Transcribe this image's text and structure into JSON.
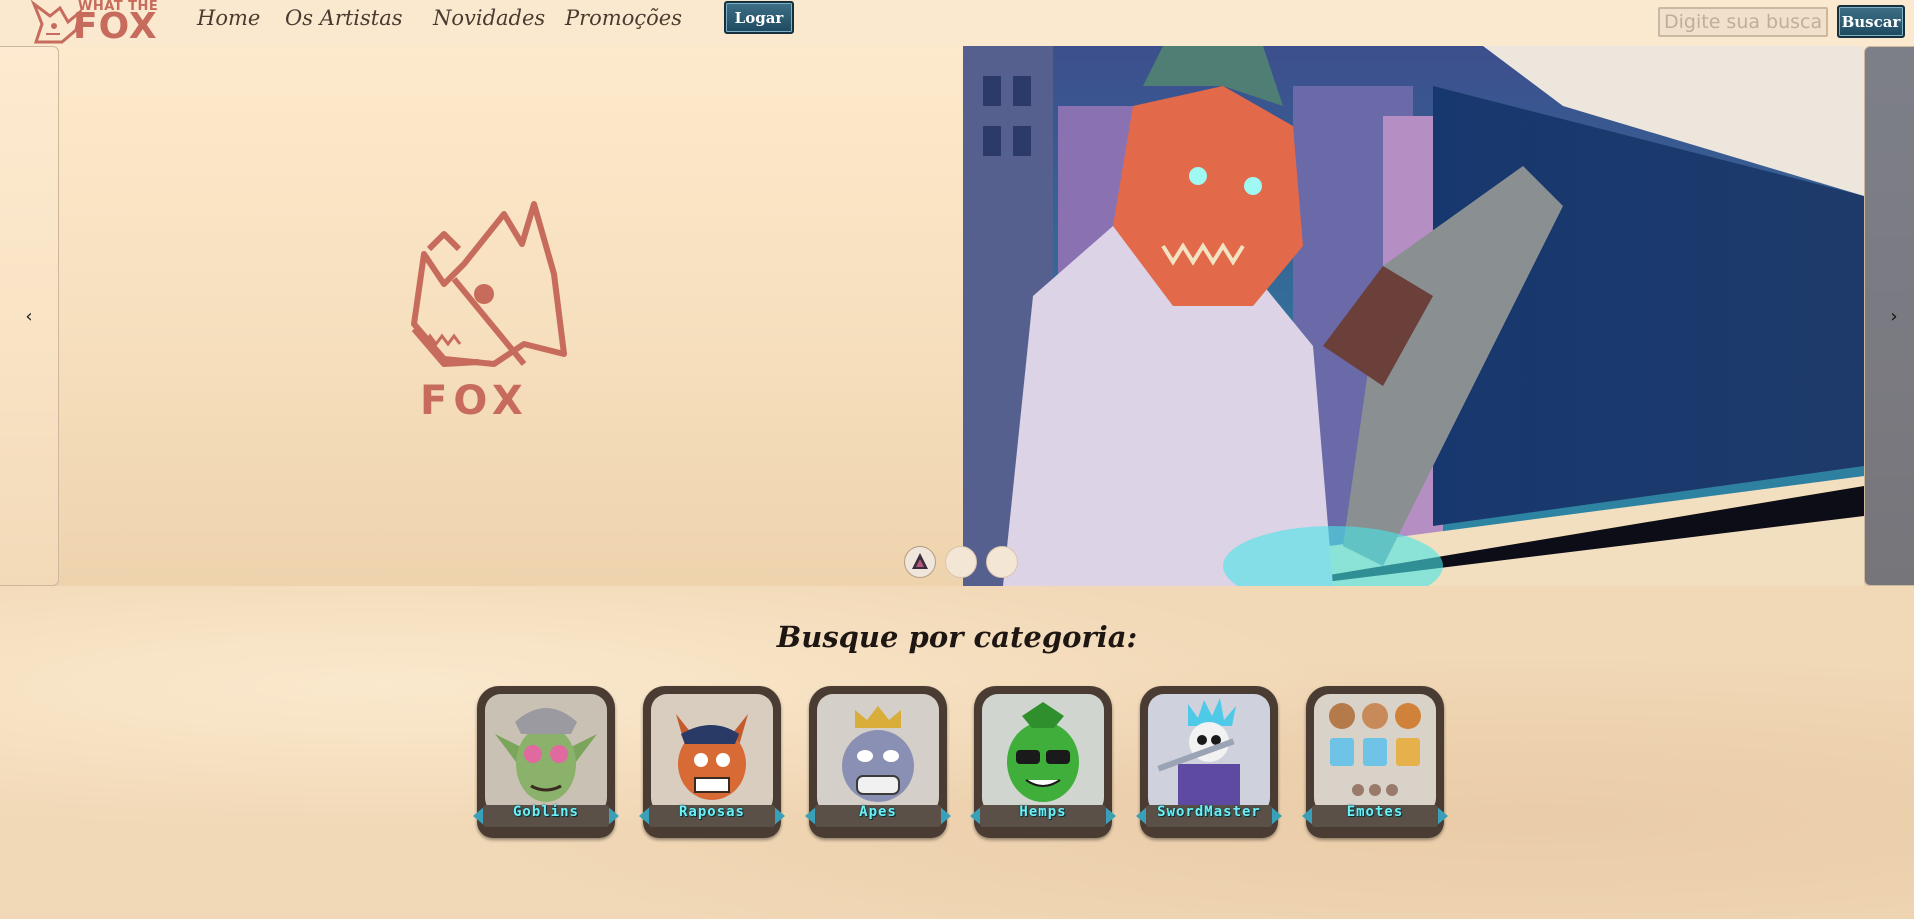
{
  "header": {
    "logo_small": "WHAT THE",
    "logo_big": "FOX",
    "nav": [
      {
        "label": "Home"
      },
      {
        "label": "Os Artistas"
      },
      {
        "label": "Novidades"
      },
      {
        "label": "Promoções"
      }
    ],
    "login_label": "Logar",
    "search_placeholder": "Digite sua busca",
    "search_button": "Buscar"
  },
  "hero": {
    "prev_label": "‹",
    "next_label": "›",
    "fox_word": "FOX",
    "slide_count": 3,
    "active_slide": 1
  },
  "categories": {
    "title": "Busque por categoria:",
    "items": [
      {
        "label": "Goblins",
        "icon": "goblin-icon"
      },
      {
        "label": "Raposas",
        "icon": "fox-icon"
      },
      {
        "label": "Apes",
        "icon": "ape-icon"
      },
      {
        "label": "Hemps",
        "icon": "hemp-icon"
      },
      {
        "label": "SwordMaster",
        "icon": "skeleton-icon"
      },
      {
        "label": "Emotes",
        "icon": "emotes-icon"
      }
    ]
  },
  "colors": {
    "brand": "#c76b5d",
    "button": "#2c5a72",
    "label_cyan": "#6df0f5"
  }
}
